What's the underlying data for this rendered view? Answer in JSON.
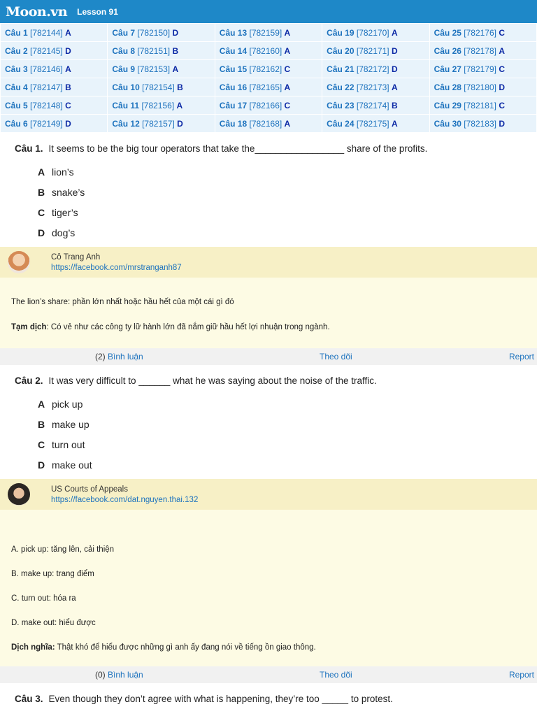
{
  "header": {
    "logo": "Moon.vn",
    "lesson": "Lesson 91"
  },
  "answer_grid": [
    [
      {
        "q": "Câu 1",
        "id": "[782144]",
        "a": "A"
      },
      {
        "q": "Câu 7",
        "id": "[782150]",
        "a": "D"
      },
      {
        "q": "Câu 13",
        "id": "[782159]",
        "a": "A"
      },
      {
        "q": "Câu 19",
        "id": "[782170]",
        "a": "A"
      },
      {
        "q": "Câu 25",
        "id": "[782176]",
        "a": "C"
      }
    ],
    [
      {
        "q": "Câu 2",
        "id": "[782145]",
        "a": "D"
      },
      {
        "q": "Câu 8",
        "id": "[782151]",
        "a": "B"
      },
      {
        "q": "Câu 14",
        "id": "[782160]",
        "a": "A"
      },
      {
        "q": "Câu 20",
        "id": "[782171]",
        "a": "D"
      },
      {
        "q": "Câu 26",
        "id": "[782178]",
        "a": "A"
      }
    ],
    [
      {
        "q": "Câu 3",
        "id": "[782146]",
        "a": "A"
      },
      {
        "q": "Câu 9",
        "id": "[782153]",
        "a": "A"
      },
      {
        "q": "Câu 15",
        "id": "[782162]",
        "a": "C"
      },
      {
        "q": "Câu 21",
        "id": "[782172]",
        "a": "D"
      },
      {
        "q": "Câu 27",
        "id": "[782179]",
        "a": "C"
      }
    ],
    [
      {
        "q": "Câu 4",
        "id": "[782147]",
        "a": "B"
      },
      {
        "q": "Câu 10",
        "id": "[782154]",
        "a": "B"
      },
      {
        "q": "Câu 16",
        "id": "[782165]",
        "a": "A"
      },
      {
        "q": "Câu 22",
        "id": "[782173]",
        "a": "A"
      },
      {
        "q": "Câu 28",
        "id": "[782180]",
        "a": "D"
      }
    ],
    [
      {
        "q": "Câu 5",
        "id": "[782148]",
        "a": "C"
      },
      {
        "q": "Câu 11",
        "id": "[782156]",
        "a": "A"
      },
      {
        "q": "Câu 17",
        "id": "[782166]",
        "a": "C"
      },
      {
        "q": "Câu 23",
        "id": "[782174]",
        "a": "B"
      },
      {
        "q": "Câu 29",
        "id": "[782181]",
        "a": "C"
      }
    ],
    [
      {
        "q": "Câu 6",
        "id": "[782149]",
        "a": "D"
      },
      {
        "q": "Câu 12",
        "id": "[782157]",
        "a": "D"
      },
      {
        "q": "Câu 18",
        "id": "[782168]",
        "a": "A"
      },
      {
        "q": "Câu 24",
        "id": "[782175]",
        "a": "A"
      },
      {
        "q": "Câu 30",
        "id": "[782183]",
        "a": "D"
      }
    ]
  ],
  "questions": [
    {
      "number": "Câu 1.",
      "text": "It seems to be the big tour operators that take the_________________ share of the profits.",
      "options": [
        {
          "letter": "A",
          "text": "lion’s"
        },
        {
          "letter": "B",
          "text": "snake’s"
        },
        {
          "letter": "C",
          "text": "tiger’s"
        },
        {
          "letter": "D",
          "text": "dog’s"
        }
      ],
      "author": {
        "name": "Cô Trang Anh",
        "link": "https://facebook.com/mrstranganh87"
      },
      "explanation": {
        "line1": "The lion’s share: phần lớn nhất hoặc hầu hết của một cái gì đó",
        "label": "Tạm dịch",
        "translation": ": Có vẻ như các công ty lữ hành lớn đã nắm giữ hầu hết lợi nhuận trong ngành."
      },
      "actions": {
        "count": "(2)",
        "comment": "Bình luận",
        "follow": "Theo dõi",
        "report": "Report"
      }
    },
    {
      "number": "Câu 2.",
      "text": "It was very difficult to ______ what he was saying about the noise of the traffic.",
      "options": [
        {
          "letter": "A",
          "text": "pick up"
        },
        {
          "letter": "B",
          "text": "make up"
        },
        {
          "letter": "C",
          "text": "turn out"
        },
        {
          "letter": "D",
          "text": "make out"
        }
      ],
      "author": {
        "name": "US Courts of Appeals",
        "link": "https://facebook.com/dat.nguyen.thai.132"
      },
      "explanation": {
        "lines": [
          "A. pick up: tăng lên, cải thiện",
          "B. make up: trang điểm",
          "C. turn out: hóa ra",
          "D. make out: hiểu được"
        ],
        "label": "Dịch nghĩa:",
        "translation": " Thật khó để hiểu được những gì anh ấy đang nói về tiếng ồn giao thông."
      },
      "actions": {
        "count": "(0)",
        "comment": "Bình luận",
        "follow": "Theo dõi",
        "report": "Report"
      }
    },
    {
      "number": "Câu 3.",
      "text": "Even though they don’t agree with what is happening, they’re too _____ to protest."
    }
  ]
}
